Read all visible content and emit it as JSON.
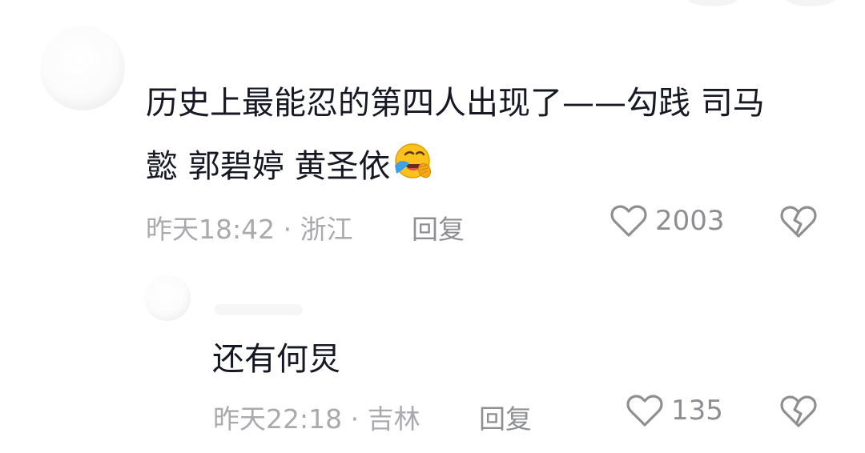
{
  "comments": [
    {
      "text_line1": "历史上最能忍的第四人出现了——勾践 司马",
      "text_line2": "懿 郭碧婷 黄圣依",
      "emoji": "facepalm-laugh-emoji",
      "time": "昨天18:42",
      "location": "浙江",
      "reply_label": "回复",
      "likes": "2003"
    },
    {
      "text": "还有何炅",
      "time": "昨天22:18",
      "location": "吉林",
      "reply_label": "回复",
      "likes": "135"
    }
  ],
  "separator": "·",
  "icons": {
    "like": "heart-outline-icon",
    "dislike": "broken-heart-icon"
  },
  "colors": {
    "text": "#161823",
    "meta": "#a9aaae",
    "action": "#8e8f93",
    "emoji_yellow": "#fcc21b",
    "emoji_tear": "#3fa0e8"
  }
}
